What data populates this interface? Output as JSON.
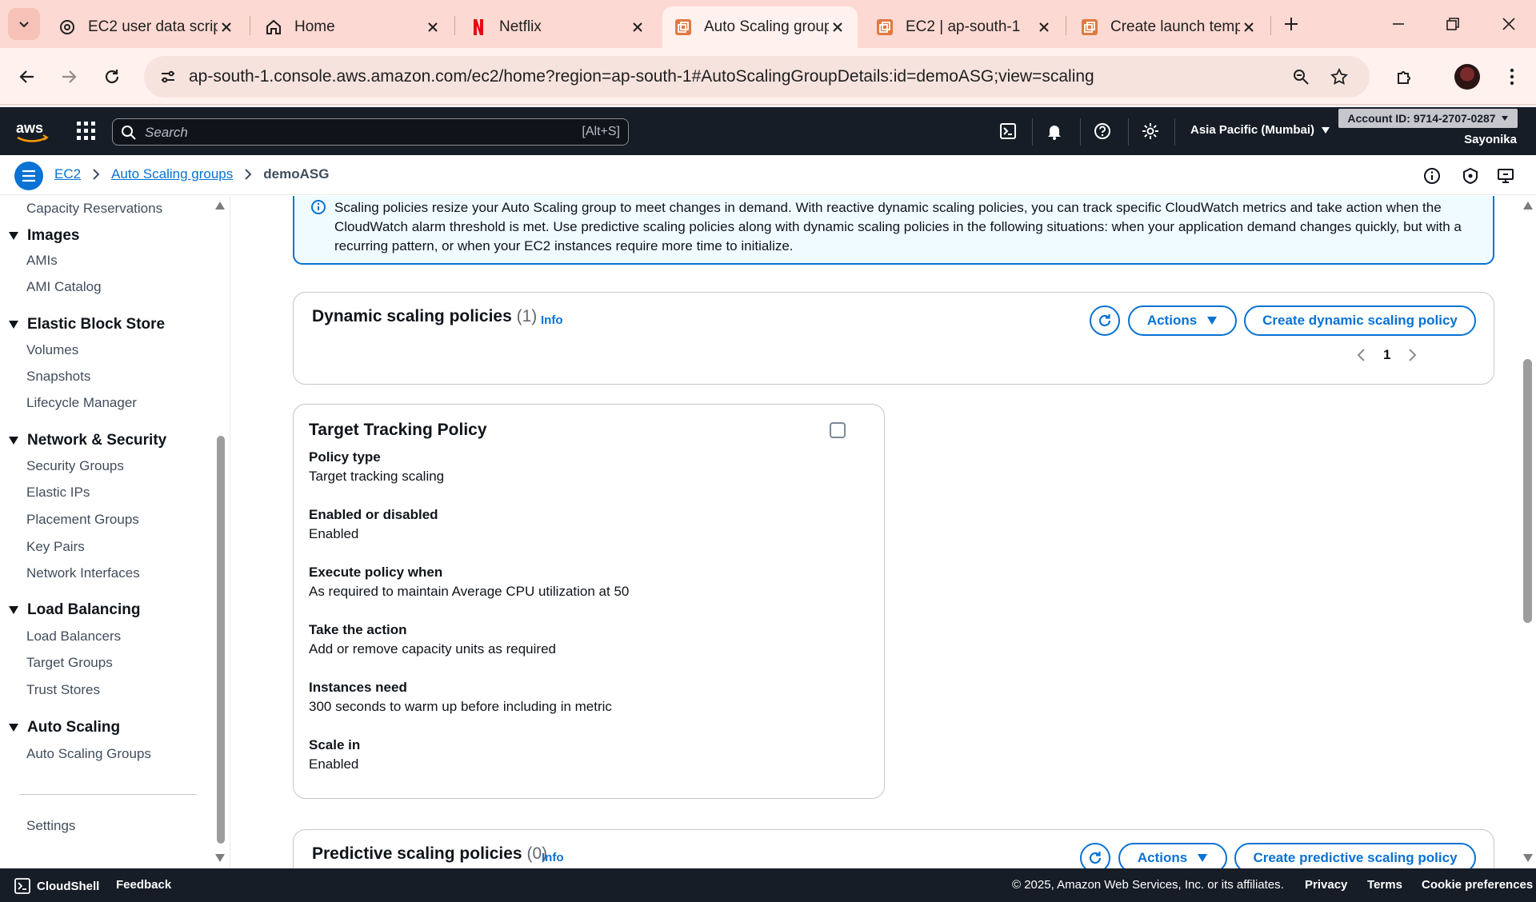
{
  "browser": {
    "tabs": [
      {
        "label": "EC2 user data scrip",
        "icon": "openai-icon"
      },
      {
        "label": "Home",
        "icon": "home-icon"
      },
      {
        "label": "Netflix",
        "icon": "netflix-icon"
      },
      {
        "label": "Auto Scaling group",
        "icon": "aws-orange-icon",
        "active": true
      },
      {
        "label": "EC2 | ap-south-1",
        "icon": "aws-orange-icon"
      },
      {
        "label": "Create launch temp",
        "icon": "aws-orange-icon"
      }
    ],
    "url": "ap-south-1.console.aws.amazon.com/ec2/home?region=ap-south-1#AutoScalingGroupDetails:id=demoASG;view=scaling"
  },
  "awsnav": {
    "search_placeholder": "Search",
    "search_shortcut": "[Alt+S]",
    "region": "Asia Pacific (Mumbai)",
    "account": "Account ID: 9714-2707-0287",
    "username": "Sayonika"
  },
  "breadcrumb": {
    "items": [
      "EC2",
      "Auto Scaling groups"
    ],
    "current": "demoASG"
  },
  "sidebar": {
    "top_item": "Capacity Reservations",
    "sections": [
      {
        "title": "Images",
        "items": [
          "AMIs",
          "AMI Catalog"
        ]
      },
      {
        "title": "Elastic Block Store",
        "items": [
          "Volumes",
          "Snapshots",
          "Lifecycle Manager"
        ]
      },
      {
        "title": "Network & Security",
        "items": [
          "Security Groups",
          "Elastic IPs",
          "Placement Groups",
          "Key Pairs",
          "Network Interfaces"
        ]
      },
      {
        "title": "Load Balancing",
        "items": [
          "Load Balancers",
          "Target Groups",
          "Trust Stores"
        ]
      },
      {
        "title": "Auto Scaling",
        "items": [
          "Auto Scaling Groups"
        ]
      }
    ],
    "settings": "Settings"
  },
  "alert": {
    "text": "Scaling policies resize your Auto Scaling group to meet changes in demand. With reactive dynamic scaling policies, you can track specific CloudWatch metrics and take action when the CloudWatch alarm threshold is met. Use predictive scaling policies along with dynamic scaling policies in the following situations: when your application demand changes quickly, but with a recurring pattern, or when your EC2 instances require more time to initialize."
  },
  "dynamic": {
    "title": "Dynamic scaling policies",
    "count": "(1)",
    "info": "Info",
    "actions": "Actions",
    "create": "Create dynamic scaling policy",
    "page": "1"
  },
  "policy": {
    "title": "Target Tracking Policy",
    "fields": [
      {
        "k": "Policy type",
        "v": "Target tracking scaling"
      },
      {
        "k": "Enabled or disabled",
        "v": "Enabled"
      },
      {
        "k": "Execute policy when",
        "v": "As required to maintain Average CPU utilization at 50"
      },
      {
        "k": "Take the action",
        "v": "Add or remove capacity units as required"
      },
      {
        "k": "Instances need",
        "v": "300 seconds to warm up before including in metric"
      },
      {
        "k": "Scale in",
        "v": "Enabled"
      }
    ]
  },
  "predictive": {
    "title": "Predictive scaling policies",
    "count": "(0)",
    "info": "Info",
    "actions": "Actions",
    "create": "Create predictive scaling policy"
  },
  "footer": {
    "cloudshell": "CloudShell",
    "feedback": "Feedback",
    "copyright": "© 2025, Amazon Web Services, Inc. or its affiliates.",
    "privacy": "Privacy",
    "terms": "Terms",
    "cookies": "Cookie preferences"
  },
  "colors": {
    "link": "#0972d3",
    "nav_bg": "#161d26",
    "tab_bar": "#fcd9d2",
    "alert_bg": "#f0fbff"
  }
}
